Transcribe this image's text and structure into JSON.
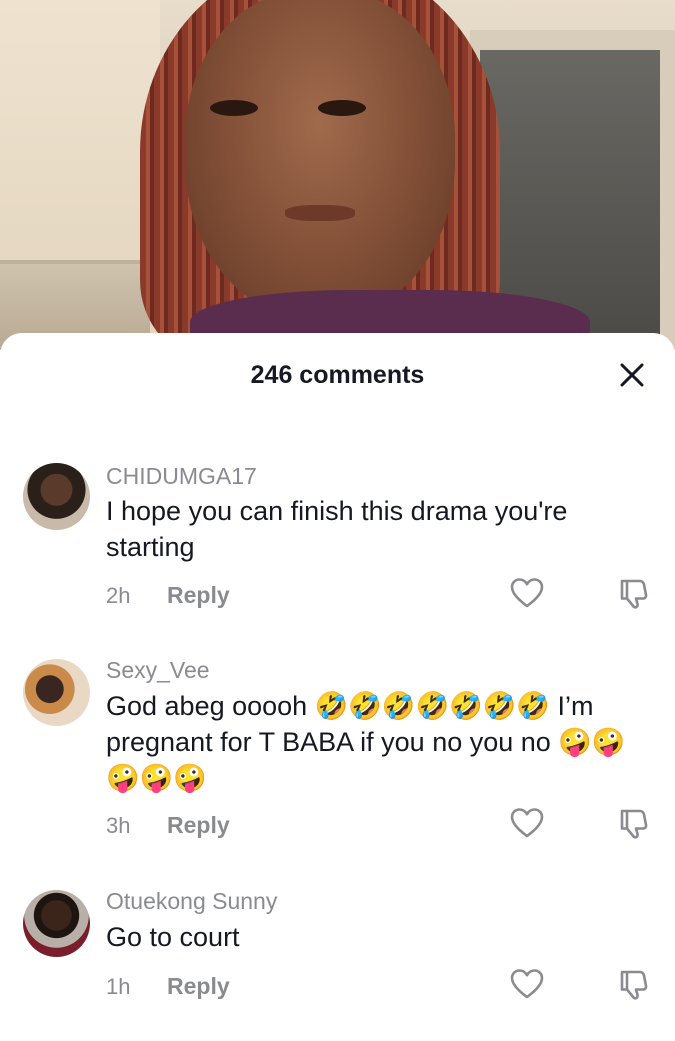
{
  "sheet": {
    "title": "246 comments",
    "close_icon": "close-icon"
  },
  "comments": [
    {
      "username": "CHIDUMGA17",
      "text": "I hope you can finish this drama you're starting",
      "time": "2h",
      "reply": "Reply"
    },
    {
      "username": "Sexy_Vee",
      "text": "God abeg ooooh 🤣🤣🤣🤣🤣🤣🤣 I’m pregnant for T BABA if you no you no 🤪🤪🤪🤪🤪",
      "time": "3h",
      "reply": "Reply"
    },
    {
      "username": "Otuekong Sunny",
      "text": "Go to court",
      "time": "1h",
      "reply": "Reply"
    }
  ],
  "icons": {
    "like": "heart-outline-icon",
    "dislike": "thumbs-down-icon"
  }
}
